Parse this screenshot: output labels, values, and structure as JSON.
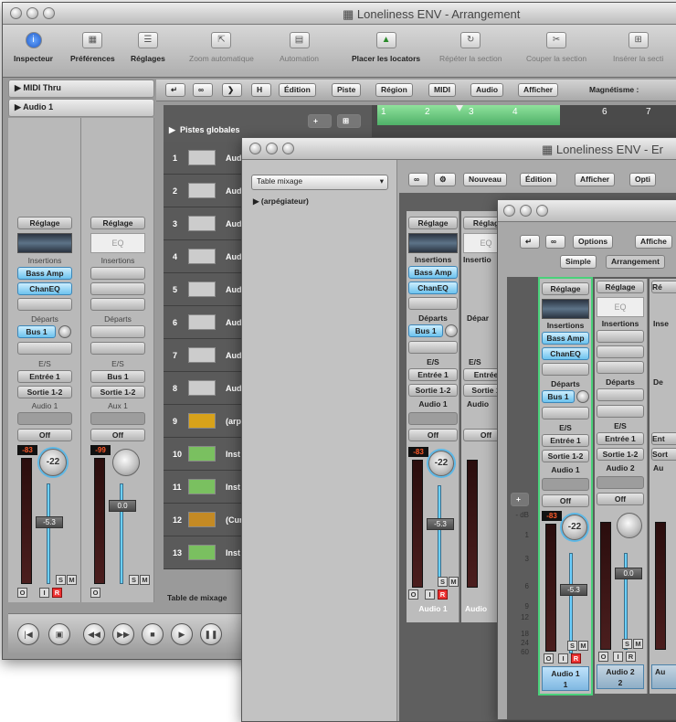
{
  "win1": {
    "title": "Loneliness ENV - Arrangement",
    "toolbar": [
      {
        "label": "Inspecteur",
        "icon": "info-icon"
      },
      {
        "label": "Préférences",
        "icon": "preferences-icon"
      },
      {
        "label": "Réglages",
        "icon": "settings-icon"
      },
      {
        "label": "Zoom automatique",
        "icon": "zoom-icon"
      },
      {
        "label": "Automation",
        "icon": "automation-icon"
      },
      {
        "label": "Placer les locators",
        "icon": "locators-icon"
      },
      {
        "label": "Répéter la section",
        "icon": "repeat-icon"
      },
      {
        "label": "Couper la section",
        "icon": "cut-icon"
      },
      {
        "label": "Insérer la secti",
        "icon": "insert-icon"
      }
    ],
    "inspector": {
      "midi_thru": "MIDI Thru",
      "audio1": "Audio 1"
    },
    "menubar": [
      "Édition",
      "Piste",
      "Région",
      "MIDI",
      "Audio",
      "Afficher"
    ],
    "magnetisme": "Magnétisme :",
    "button_h": "H",
    "global_tracks": "Pistes globales",
    "ruler": [
      "1",
      "2",
      "3",
      "4",
      "6",
      "7"
    ],
    "tracks": [
      {
        "num": "1",
        "name": "Aud"
      },
      {
        "num": "2",
        "name": "Aud"
      },
      {
        "num": "3",
        "name": "Aud"
      },
      {
        "num": "4",
        "name": "Aud"
      },
      {
        "num": "5",
        "name": "Aud"
      },
      {
        "num": "6",
        "name": "Aud"
      },
      {
        "num": "7",
        "name": "Aud"
      },
      {
        "num": "8",
        "name": "Aud"
      },
      {
        "num": "9",
        "name": "(arp"
      },
      {
        "num": "10",
        "name": "Inst"
      },
      {
        "num": "11",
        "name": "Inst"
      },
      {
        "num": "12",
        "name": "(Cur"
      },
      {
        "num": "13",
        "name": "Inst"
      }
    ],
    "table_mixage": "Table de mixage",
    "strips": [
      {
        "reglage": "Réglage",
        "eq": "",
        "insertions": "Insertions",
        "plugins": [
          "Bass Amp",
          "ChanEQ"
        ],
        "departs": "Départs",
        "bus": "Bus 1",
        "es": "E/S",
        "input": "Entrée 1",
        "output": "Sortie 1-2",
        "name": "Audio 1",
        "off": "Off",
        "meter": "-83",
        "knob": "-22",
        "fader": "-5.3"
      },
      {
        "reglage": "Réglage",
        "eq": "EQ",
        "insertions": "Insertions",
        "plugins": [],
        "departs": "Départs",
        "bus": "",
        "es": "E/S",
        "input": "Bus 1",
        "output": "Sortie 1-2",
        "name": "Aux 1",
        "off": "Off",
        "meter": "-99",
        "knob": "",
        "fader": "0.0"
      }
    ],
    "sm": [
      "S",
      "M"
    ],
    "oir": [
      "O",
      "I",
      "R"
    ]
  },
  "win2": {
    "title": "Loneliness ENV - Er",
    "dropdown": "Table mixage",
    "arpeggiator": "(arpégiateur)",
    "menus": [
      "Nouveau",
      "Édition",
      "Afficher",
      "Opti"
    ],
    "strips": [
      {
        "reglage": "Réglage",
        "eq": "",
        "insertions": "Insertions",
        "plugins": [
          "Bass Amp",
          "ChanEQ"
        ],
        "departs": "Départs",
        "bus": "Bus 1",
        "es": "E/S",
        "input": "Entrée 1",
        "output": "Sortie 1-2",
        "name": "Audio 1",
        "off": "Off",
        "meter": "-83",
        "knob": "-22",
        "fader": "-5.3",
        "footer": "Audio 1"
      },
      {
        "reglage": "Réglag",
        "eq": "EQ",
        "insertions": "Insertio",
        "plugins": [],
        "departs": "Dépar",
        "bus": "",
        "es": "E/S",
        "input": "Entrée",
        "output": "Sortie 1",
        "name": "Audio",
        "off": "Off",
        "meter": "",
        "knob": "",
        "fader": "",
        "footer": "Audio"
      }
    ]
  },
  "win3": {
    "menus": [
      "Options",
      "Affiche"
    ],
    "tabs": [
      "Simple",
      "Arrangement"
    ],
    "plus": "+",
    "db_label": "- dB",
    "db_scale": [
      "1",
      "3",
      "6",
      "9",
      "12",
      "18",
      "24",
      "60"
    ],
    "strips": [
      {
        "reglage": "Réglage",
        "eq": "",
        "insertions": "Insertions",
        "plugins": [
          "Bass Amp",
          "ChanEQ"
        ],
        "departs": "Départs",
        "bus": "Bus 1",
        "es": "E/S",
        "input": "Entrée 1",
        "output": "Sortie 1-2",
        "name": "Audio 1",
        "off": "Off",
        "meter": "-83",
        "knob": "-22",
        "fader": "-5.3",
        "footer": "Audio 1",
        "footer_num": "1"
      },
      {
        "reglage": "Réglage",
        "eq": "EQ",
        "insertions": "Insertions",
        "plugins": [],
        "departs": "Départs",
        "bus": "",
        "es": "E/S",
        "input": "Entrée 1",
        "output": "Sortie 1-2",
        "name": "Audio 2",
        "off": "Off",
        "meter": "",
        "knob": "",
        "fader": "0.0",
        "footer": "Audio 2",
        "footer_num": "2"
      },
      {
        "reglage": "Ré",
        "eq": "",
        "insertions": "Inse",
        "plugins": [],
        "departs": "De",
        "bus": "",
        "es": "",
        "input": "Ent",
        "output": "Sort",
        "name": "Au",
        "off": "",
        "meter": "",
        "knob": "",
        "fader": "",
        "footer": "Au",
        "footer_num": ""
      }
    ]
  }
}
